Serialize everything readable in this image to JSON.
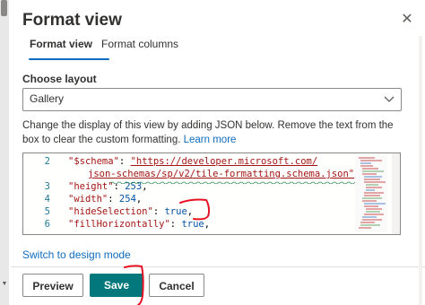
{
  "panel": {
    "title": "Format view",
    "close_icon": "close-icon"
  },
  "tabs": [
    {
      "label": "Format view",
      "active": true
    },
    {
      "label": "Format columns",
      "active": false
    }
  ],
  "layout": {
    "label": "Choose layout",
    "selected": "Gallery",
    "chevron_icon": "chevron-down-icon"
  },
  "description": {
    "text": "Change the display of this view by adding JSON below. Remove the text from the box to clear the custom formatting.",
    "link": "Learn more"
  },
  "editor": {
    "line_numbers": [
      "2",
      "",
      "3",
      "4",
      "5",
      "6"
    ],
    "lines": {
      "l2_key": "\"$schema\"",
      "l2_colon": ": ",
      "l2_url_a": "\"https://developer.microsoft.com/",
      "l2_url_b": "json-schemas/sp/v2/tile-formatting.schema.json\"",
      "l2_end": ",",
      "l3_key": "\"height\"",
      "l3_val": "253",
      "l4_key": "\"width\"",
      "l4_val": "254",
      "l5_key": "\"hideSelection\"",
      "l5_val": "true",
      "l6_key": "\"fillHorizontally\"",
      "l6_val": "true"
    }
  },
  "switch_link": "Switch to design mode",
  "buttons": {
    "preview": "Preview",
    "save": "Save",
    "cancel": "Cancel"
  },
  "colors": {
    "accent": "#0f6cbd",
    "save_button": "#03787c",
    "annotation_red": "#e81123"
  }
}
